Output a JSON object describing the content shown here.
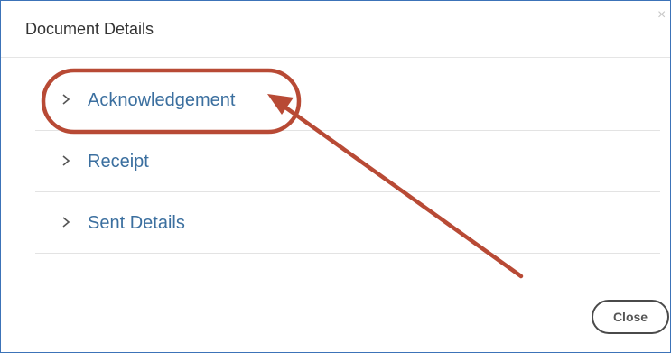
{
  "dialog": {
    "title": "Document Details",
    "close_glyph": "×",
    "close_button_label": "Close"
  },
  "panels": [
    {
      "label": "Acknowledgement",
      "icon": "chevron-right-icon"
    },
    {
      "label": "Receipt",
      "icon": "chevron-right-icon"
    },
    {
      "label": "Sent Details",
      "icon": "chevron-right-icon"
    }
  ],
  "colors": {
    "dialog_border": "#3c73b8",
    "link_text": "#3b6f9f",
    "annotation_red": "#b84a35"
  },
  "annotation": {
    "highlighted_item": "Acknowledgement",
    "shapes": [
      "highlight-ellipse",
      "pointer-arrow"
    ]
  }
}
